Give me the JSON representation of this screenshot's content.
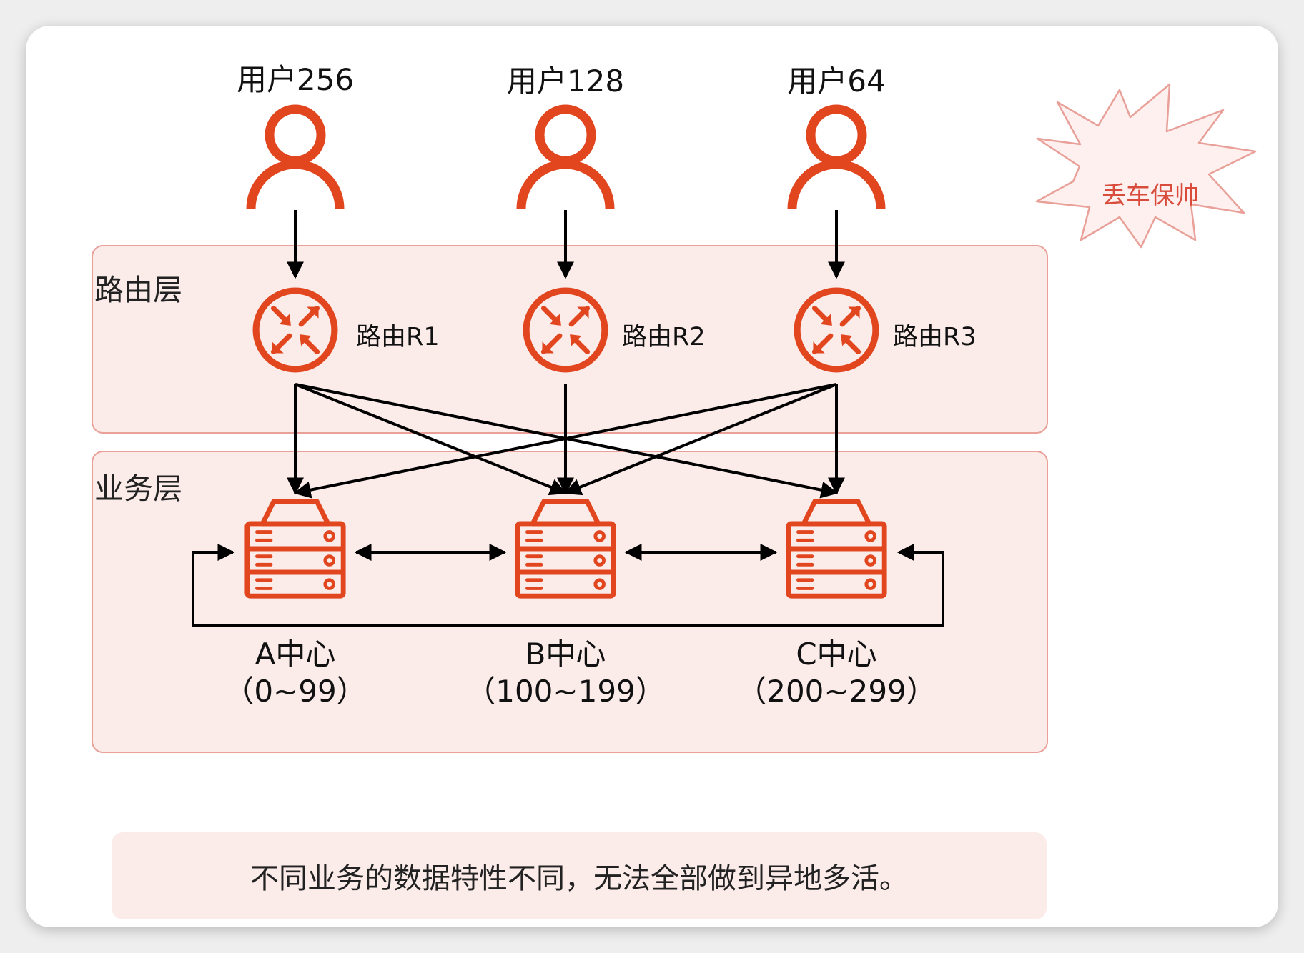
{
  "colors": {
    "accent": "#e1461f",
    "layer_fill": "#fbecea",
    "layer_border": "#e9a099",
    "badge_text": "#d94b3b",
    "arrow": "#000000"
  },
  "users": [
    {
      "label": "用户256",
      "icon": "user-icon"
    },
    {
      "label": "用户128",
      "icon": "user-icon"
    },
    {
      "label": "用户64",
      "icon": "user-icon"
    }
  ],
  "routing_layer": {
    "title": "路由层",
    "routers": [
      {
        "label": "路由R1",
        "icon": "router-icon"
      },
      {
        "label": "路由R2",
        "icon": "router-icon"
      },
      {
        "label": "路由R3",
        "icon": "router-icon"
      }
    ]
  },
  "business_layer": {
    "title": "业务层",
    "centers": [
      {
        "name": "A中心",
        "range": "（0~99）",
        "icon": "server-icon"
      },
      {
        "name": "B中心",
        "range": "（100~199）",
        "icon": "server-icon"
      },
      {
        "name": "C中心",
        "range": "（200~299）",
        "icon": "server-icon"
      }
    ]
  },
  "badge": {
    "text": "丢车保帅",
    "icon": "starburst-icon"
  },
  "note": {
    "text": "不同业务的数据特性不同，无法全部做到异地多活。"
  }
}
